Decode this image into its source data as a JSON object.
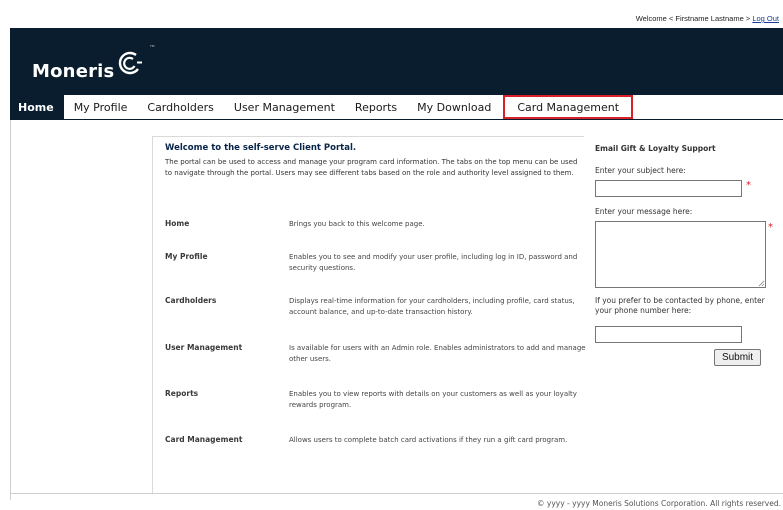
{
  "topbar": {
    "welcome_text": "Welcome < Firstname Lastname >",
    "logout_label": "Log Out"
  },
  "header": {
    "brand": "Moneris",
    "tm": "TM"
  },
  "nav": {
    "items": [
      {
        "label": "Home"
      },
      {
        "label": "My Profile"
      },
      {
        "label": "Cardholders"
      },
      {
        "label": "User Management"
      },
      {
        "label": "Reports"
      },
      {
        "label": "My Download"
      },
      {
        "label": "Card Management"
      }
    ]
  },
  "main": {
    "title": "Welcome to the self-serve Client Portal.",
    "intro": "The portal can be used to access and manage your program card information. The tabs on the top menu can be used to navigate through the portal. Users may see different tabs based on the role and authority level assigned to them.",
    "rows": [
      {
        "term": "Home",
        "desc": "Brings you back to this welcome page."
      },
      {
        "term": "My Profile",
        "desc": "Enables you to see and modify your user profile, including log in ID, password and security questions."
      },
      {
        "term": "Cardholders",
        "desc": "Displays real-time information for your cardholders, including profile, card status, account balance, and up-to-date transaction history."
      },
      {
        "term": "User Management",
        "desc": "Is available for users with an Admin role. Enables administrators to add and manage other users."
      },
      {
        "term": "Reports",
        "desc": "Enables you to view reports with details on your customers as well as your loyalty rewards program."
      },
      {
        "term": "Card Management",
        "desc": "Allows users to complete batch card activations if they run a gift card program."
      }
    ]
  },
  "support": {
    "title": "Email Gift & Loyalty Support",
    "subject_label": "Enter your subject here:",
    "subject_value": "",
    "message_label": "Enter your message here:",
    "message_value": "",
    "phone_label": "If you prefer to be contacted by phone, enter your phone number here:",
    "phone_value": "",
    "required_mark": "*",
    "submit_label": "Submit"
  },
  "footer": {
    "text": "© yyyy - yyyy  Moneris Solutions Corporation. All rights reserved."
  },
  "colors": {
    "header_bg": "#091d2e",
    "highlight": "#d6202a",
    "required": "#d6202a"
  }
}
